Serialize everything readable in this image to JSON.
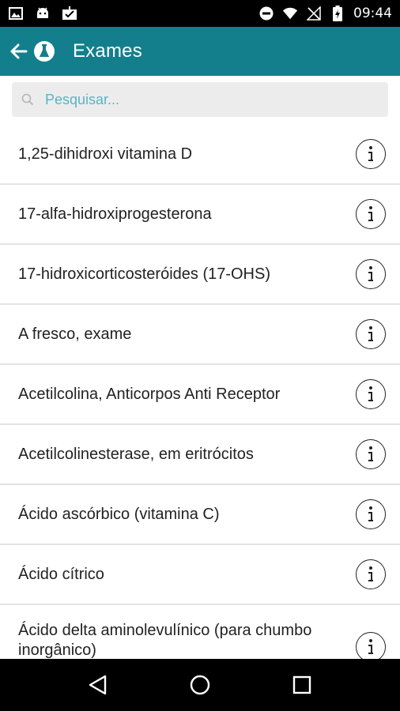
{
  "status_bar": {
    "time": "09:44",
    "icons": [
      "image-icon",
      "android-icon",
      "download-done-icon",
      "do-not-disturb-icon",
      "wifi-icon",
      "no-signal-icon",
      "battery-charging-icon"
    ]
  },
  "app_bar": {
    "title": "Exames",
    "back_icon": "arrow-left-icon",
    "logo_icon": "flask-icon",
    "background": "#137f8c"
  },
  "search": {
    "placeholder": "Pesquisar...",
    "value": "",
    "icon": "search-icon"
  },
  "exams": [
    {
      "label": "1,25-dihidroxi vitamina D"
    },
    {
      "label": "17-alfa-hidroxiprogesterona"
    },
    {
      "label": "17-hidroxicorticosteróides (17-OHS)"
    },
    {
      "label": "A fresco, exame"
    },
    {
      "label": "Acetilcolina, Anticorpos Anti Receptor"
    },
    {
      "label": "Acetilcolinesterase, em eritrócitos"
    },
    {
      "label": "Ácido ascórbico (vitamina C)"
    },
    {
      "label": "Ácido cítrico"
    },
    {
      "label": "Ácido delta aminolevulínico (para chumbo inorgânico)"
    }
  ],
  "info_icon": "info-icon",
  "nav_bar": {
    "icons": [
      "back-triangle-icon",
      "home-circle-icon",
      "recents-square-icon"
    ]
  }
}
